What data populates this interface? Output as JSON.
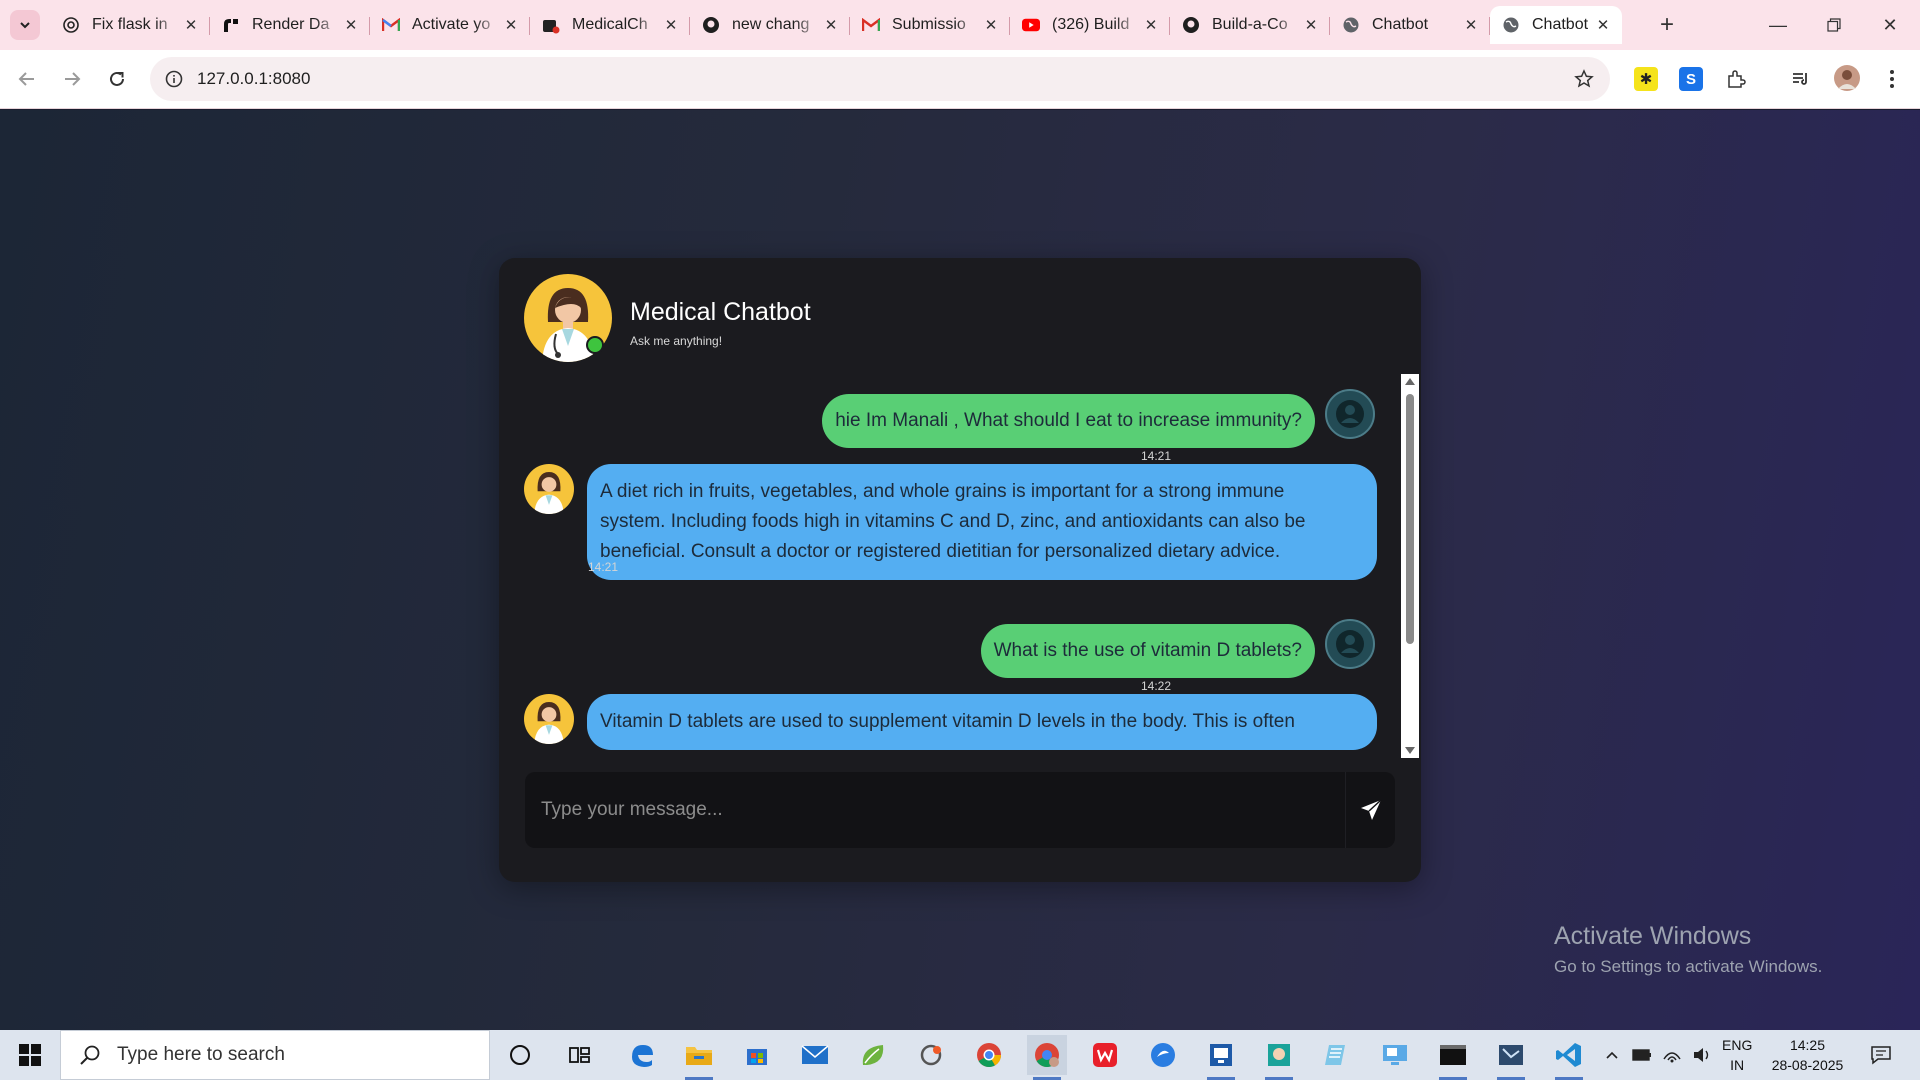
{
  "browser": {
    "tabs": [
      {
        "title": "Fix flask in",
        "icon": "openai-icon",
        "active": false
      },
      {
        "title": "Render Da",
        "icon": "render-icon",
        "active": false
      },
      {
        "title": "Activate yo",
        "icon": "gmail-icon",
        "active": false
      },
      {
        "title": "MedicalCh",
        "icon": "medicalchat-icon",
        "active": false
      },
      {
        "title": "new chang",
        "icon": "github-icon",
        "active": false
      },
      {
        "title": "Submissio",
        "icon": "gmail-icon",
        "active": false
      },
      {
        "title": "(326) Build",
        "icon": "youtube-icon",
        "active": false
      },
      {
        "title": "Build-a-Co",
        "icon": "github-icon",
        "active": false
      },
      {
        "title": "Chatbot",
        "icon": "globe-icon",
        "active": false
      },
      {
        "title": "Chatbot",
        "icon": "globe-icon",
        "active": true
      }
    ],
    "url": "127.0.0.1:8080",
    "colors": {
      "tabstrip": "#fbe3ea",
      "toolbar": "#ffffff"
    }
  },
  "chatbot": {
    "title": "Medical Chatbot",
    "subtitle": "Ask me anything!",
    "input_placeholder": "Type your message...",
    "colors": {
      "user_bubble": "#59cf75",
      "bot_bubble": "#54aef2",
      "card": "#1b1b1f"
    },
    "messages": [
      {
        "sender": "user",
        "lines": [
          "hie Im Manali , What should I eat to increase immunity?"
        ],
        "time": "14:21"
      },
      {
        "sender": "bot",
        "lines": [
          "A diet rich in fruits, vegetables, and whole grains is important for a strong immune",
          "system. Including foods high in vitamins C and D, zinc, and antioxidants can also be",
          "beneficial. Consult a doctor or registered dietitian for personalized dietary advice."
        ],
        "time": "14:21"
      },
      {
        "sender": "user",
        "lines": [
          "What is the use of vitamin D tablets?"
        ],
        "time": "14:22"
      },
      {
        "sender": "bot",
        "lines": [
          "Vitamin D tablets are used to supplement vitamin D levels in the body. This is often"
        ],
        "time": ""
      }
    ]
  },
  "watermark": {
    "title": "Activate Windows",
    "subtitle": "Go to Settings to activate Windows."
  },
  "taskbar": {
    "search_placeholder": "Type here to search",
    "language_line1": "ENG",
    "language_line2": "IN",
    "time": "14:25",
    "date": "28-08-2025"
  }
}
